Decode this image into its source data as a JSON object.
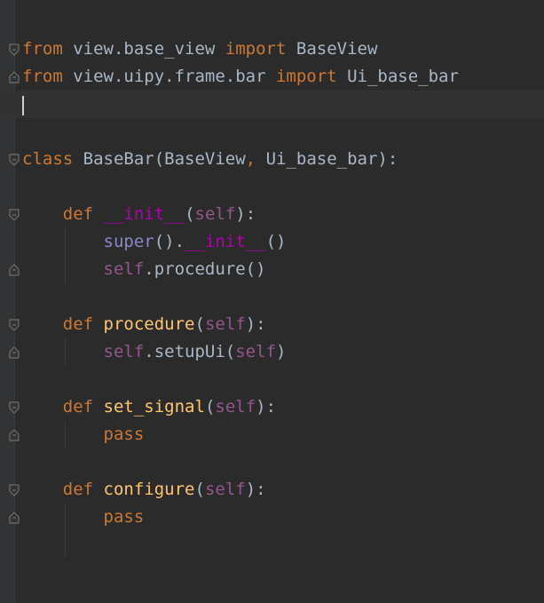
{
  "editor": {
    "colors": {
      "background": "#2b2b2b",
      "current_line": "#323232",
      "keyword": "#cc7832",
      "function": "#ffc66d",
      "dunder": "#b200b2",
      "self": "#94558d",
      "builtin": "#8888c6",
      "text": "#a9b7c6"
    },
    "lines": [
      {
        "tokens": []
      },
      {
        "tokens": [
          {
            "t": "from",
            "c": "kw"
          },
          {
            "t": " view.base_view ",
            "c": "txt"
          },
          {
            "t": "import",
            "c": "kw"
          },
          {
            "t": " BaseView",
            "c": "txt"
          }
        ]
      },
      {
        "tokens": [
          {
            "t": "from",
            "c": "kw"
          },
          {
            "t": " view.uipy.frame.bar ",
            "c": "txt"
          },
          {
            "t": "import",
            "c": "kw"
          },
          {
            "t": " Ui_base_bar",
            "c": "txt"
          }
        ]
      },
      {
        "tokens": [],
        "current": true
      },
      {
        "tokens": []
      },
      {
        "tokens": [
          {
            "t": "class",
            "c": "kw"
          },
          {
            "t": " BaseBar(BaseView",
            "c": "txt"
          },
          {
            "t": ",",
            "c": "kw"
          },
          {
            "t": " Ui_base_bar):",
            "c": "txt"
          }
        ]
      },
      {
        "tokens": []
      },
      {
        "tokens": [
          {
            "t": "    ",
            "c": "txt"
          },
          {
            "t": "def",
            "c": "kw"
          },
          {
            "t": " ",
            "c": "txt"
          },
          {
            "t": "__init__",
            "c": "dunder"
          },
          {
            "t": "(",
            "c": "txt"
          },
          {
            "t": "self",
            "c": "selfk"
          },
          {
            "t": "):",
            "c": "txt"
          }
        ]
      },
      {
        "tokens": [
          {
            "t": "        ",
            "c": "txt"
          },
          {
            "t": "super",
            "c": "bi"
          },
          {
            "t": "().",
            "c": "txt"
          },
          {
            "t": "__init__",
            "c": "dunder"
          },
          {
            "t": "()",
            "c": "txt"
          }
        ]
      },
      {
        "tokens": [
          {
            "t": "        ",
            "c": "txt"
          },
          {
            "t": "self",
            "c": "selfk"
          },
          {
            "t": ".procedure()",
            "c": "txt"
          }
        ]
      },
      {
        "tokens": []
      },
      {
        "tokens": [
          {
            "t": "    ",
            "c": "txt"
          },
          {
            "t": "def",
            "c": "kw"
          },
          {
            "t": " ",
            "c": "txt"
          },
          {
            "t": "procedure",
            "c": "fn"
          },
          {
            "t": "(",
            "c": "txt"
          },
          {
            "t": "self",
            "c": "selfk"
          },
          {
            "t": "):",
            "c": "txt"
          }
        ]
      },
      {
        "tokens": [
          {
            "t": "        ",
            "c": "txt"
          },
          {
            "t": "self",
            "c": "selfk"
          },
          {
            "t": ".setupUi(",
            "c": "txt"
          },
          {
            "t": "self",
            "c": "selfk"
          },
          {
            "t": ")",
            "c": "txt"
          }
        ]
      },
      {
        "tokens": []
      },
      {
        "tokens": [
          {
            "t": "    ",
            "c": "txt"
          },
          {
            "t": "def",
            "c": "kw"
          },
          {
            "t": " ",
            "c": "txt"
          },
          {
            "t": "set_signal",
            "c": "fn"
          },
          {
            "t": "(",
            "c": "txt"
          },
          {
            "t": "self",
            "c": "selfk"
          },
          {
            "t": "):",
            "c": "txt"
          }
        ]
      },
      {
        "tokens": [
          {
            "t": "        ",
            "c": "txt"
          },
          {
            "t": "pass",
            "c": "kw"
          }
        ]
      },
      {
        "tokens": []
      },
      {
        "tokens": [
          {
            "t": "    ",
            "c": "txt"
          },
          {
            "t": "def",
            "c": "kw"
          },
          {
            "t": " ",
            "c": "txt"
          },
          {
            "t": "configure",
            "c": "fn"
          },
          {
            "t": "(",
            "c": "txt"
          },
          {
            "t": "self",
            "c": "selfk"
          },
          {
            "t": "):",
            "c": "txt"
          }
        ]
      },
      {
        "tokens": [
          {
            "t": "        ",
            "c": "txt"
          },
          {
            "t": "pass",
            "c": "kw"
          }
        ]
      },
      {
        "tokens": []
      },
      {
        "tokens": []
      },
      {
        "tokens": []
      }
    ]
  }
}
